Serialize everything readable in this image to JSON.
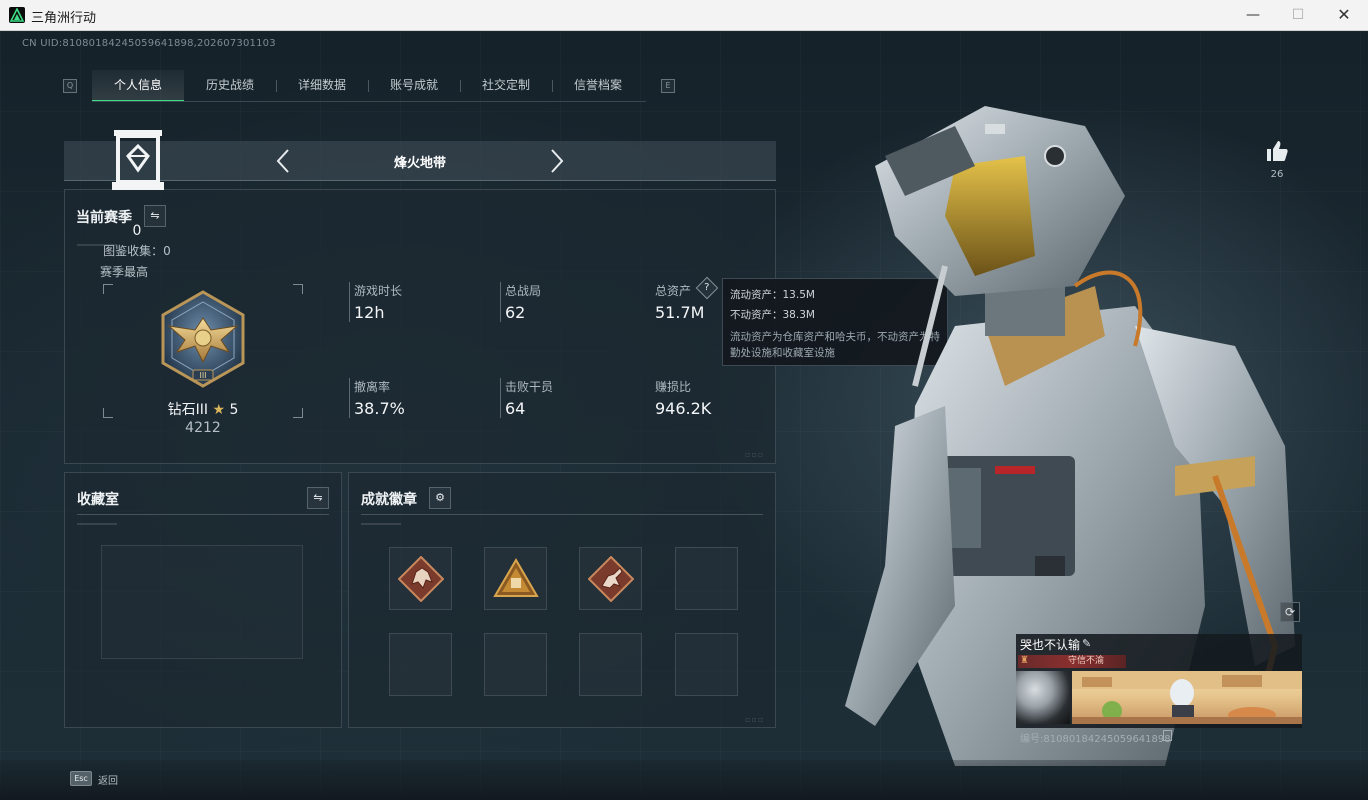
{
  "window": {
    "title": "三角洲行动",
    "minimize": "—",
    "maximize": "☐",
    "close": "✕"
  },
  "uid_header": "CN UID:8108018424505964189​8,202607301103",
  "tabs": {
    "left_badge": "Q",
    "right_badge": "E",
    "items": [
      {
        "label": "个人信息",
        "active": true
      },
      {
        "label": "历史战绩",
        "active": false
      },
      {
        "label": "详细数据",
        "active": false
      },
      {
        "label": "账号成就",
        "active": false
      },
      {
        "label": "社交定制",
        "active": false
      },
      {
        "label": "信誉档案",
        "active": false
      }
    ]
  },
  "mode": {
    "title": "烽火地带",
    "prev": "‹",
    "next": "›"
  },
  "season": {
    "title": "当前赛季",
    "swap_icon": "⇋",
    "best_label": "赛季最高",
    "rank_name": "钻石III",
    "rank_star_icon": "★",
    "rank_stars": "5",
    "rank_score": "4212",
    "stats": [
      {
        "label": "游戏时长",
        "value": "12h"
      },
      {
        "label": "总战局",
        "value": "62"
      },
      {
        "label": "总资产",
        "value": "51.7M"
      },
      {
        "label": "撤离率",
        "value": "38.7%"
      },
      {
        "label": "击败干员",
        "value": "64"
      },
      {
        "label": "赚损比",
        "value": "946.2K"
      }
    ],
    "help_icon": "?"
  },
  "tooltip": {
    "line1": "流动资产：13.5M",
    "line2": "不动资产：38.3M",
    "desc": "流动资产为仓库资产和哈夫币，不动资产为特勤处设施和收藏室设施"
  },
  "collection": {
    "title": "收藏室",
    "swap_icon": "⇋",
    "count": "0",
    "collect_label": "图鉴收集：0"
  },
  "badges": {
    "title": "成就徽章",
    "settings_icon": "⚙",
    "slots": [
      {
        "icon": "dragon-badge-icon",
        "filled": true
      },
      {
        "icon": "pyramid-badge-icon",
        "filled": true
      },
      {
        "icon": "runner-badge-icon",
        "filled": true
      },
      {
        "icon": "",
        "filled": false
      },
      {
        "icon": "",
        "filled": false
      },
      {
        "icon": "",
        "filled": false
      },
      {
        "icon": "",
        "filled": false
      },
      {
        "icon": "",
        "filled": false
      }
    ]
  },
  "like": {
    "count": "26"
  },
  "player": {
    "name": "哭也不认输",
    "edit_icon": "✎",
    "title_badge": "守信不渝",
    "uid": "编号:8108018424505964189​8"
  },
  "footer": {
    "esc_key": "Esc",
    "back_label": "返回"
  },
  "colors": {
    "accent_green": "#3ddc86",
    "tooltip_bg": "#12181d",
    "title_strip": "#8a2f2f"
  }
}
